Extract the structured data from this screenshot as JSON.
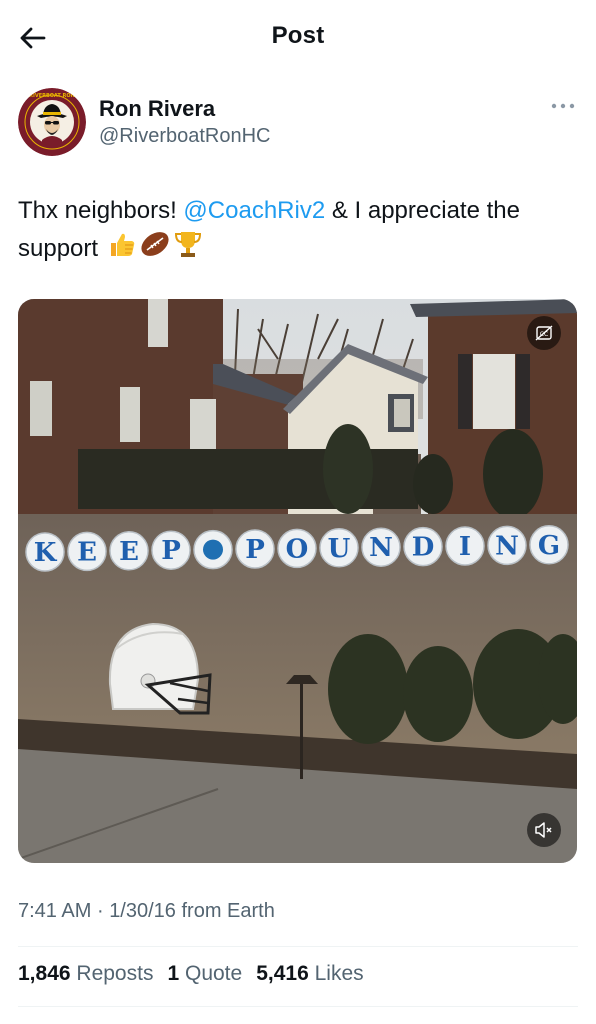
{
  "header": {
    "title": "Post",
    "back_icon": "arrow-left-icon"
  },
  "author": {
    "name": "Ron Rivera",
    "handle": "@RiverboatRonHC",
    "avatar_text": "RIVERBOAT RON",
    "avatar_colors": {
      "ring": "#7a1c2a",
      "accent": "#e8b500"
    }
  },
  "tweet": {
    "text_before": "Thx neighbors! ",
    "mention": "@CoachRiv2",
    "text_after": " & I appreciate the support",
    "emojis": [
      "thumbs-up-icon",
      "football-icon",
      "trophy-icon"
    ]
  },
  "media": {
    "sign_letters": [
      "K",
      "E",
      "E",
      "P",
      "",
      "P",
      "O",
      "U",
      "N",
      "D",
      "I",
      "N",
      "G"
    ],
    "cc_icon": "closed-captions-icon",
    "mute_icon": "volume-muted-icon"
  },
  "meta": {
    "time": "7:41 AM",
    "separator": "·",
    "date": "1/30/16",
    "source": "from Earth"
  },
  "stats": {
    "reposts_count": "1,846",
    "reposts_label": "Reposts",
    "quotes_count": "1",
    "quotes_label": "Quote",
    "likes_count": "5,416",
    "likes_label": "Likes"
  },
  "colors": {
    "link": "#1d9bf0",
    "secondary_text": "#536471",
    "primary_text": "#0f1419"
  }
}
